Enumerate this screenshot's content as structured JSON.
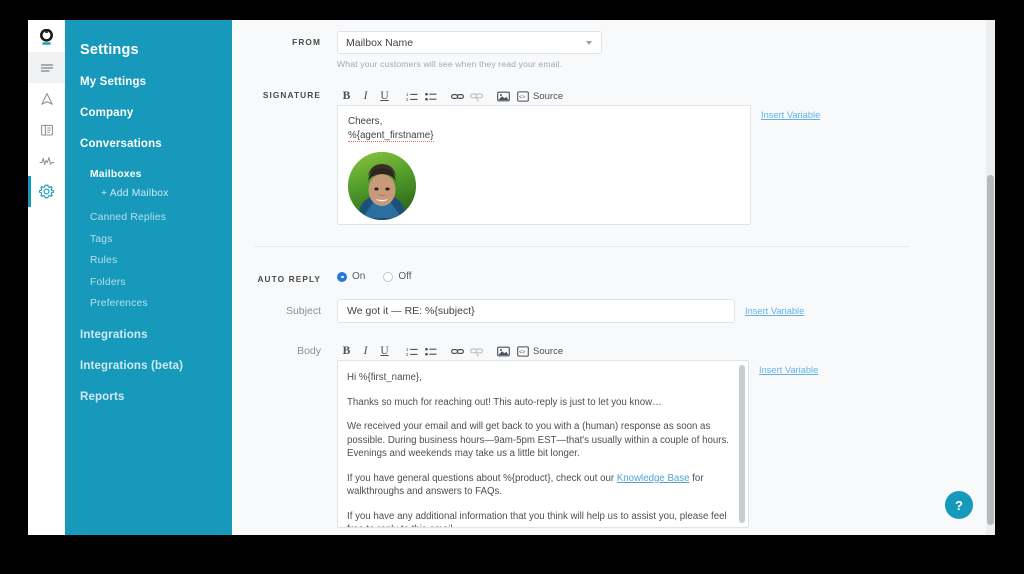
{
  "app": {
    "logo_icon": "groove-logo-icon",
    "rail_items": [
      {
        "name": "inbox-icon",
        "active": true
      },
      {
        "name": "navigation-icon",
        "active": false
      },
      {
        "name": "knowledge-base-icon",
        "active": false
      },
      {
        "name": "reports-pulse-icon",
        "active": false
      },
      {
        "name": "settings-gear-icon",
        "active": true
      }
    ],
    "accent_color": "#1799bc",
    "link_color": "#60b3e8",
    "radio_on_color": "#2479e0"
  },
  "sidebar": {
    "title": "Settings",
    "items": [
      {
        "label": "My Settings",
        "level": "top"
      },
      {
        "label": "Company",
        "level": "top"
      },
      {
        "label": "Conversations",
        "level": "top",
        "selected": true
      },
      {
        "label": "Mailboxes",
        "level": "sub",
        "selected": true
      },
      {
        "label": "+ Add Mailbox",
        "level": "add"
      },
      {
        "label": "Canned Replies",
        "level": "sub"
      },
      {
        "label": "Tags",
        "level": "sub"
      },
      {
        "label": "Rules",
        "level": "sub"
      },
      {
        "label": "Folders",
        "level": "sub"
      },
      {
        "label": "Preferences",
        "level": "sub"
      },
      {
        "label": "Integrations",
        "level": "top"
      },
      {
        "label": "Integrations (beta)",
        "level": "top"
      },
      {
        "label": "Reports",
        "level": "top"
      }
    ]
  },
  "main": {
    "from": {
      "label": "FROM",
      "value": "Mailbox Name",
      "help": "What your customers will see when they read your email."
    },
    "signature": {
      "label": "SIGNATURE",
      "toolbar": {
        "bold": "B",
        "italic": "I",
        "underline": "U",
        "ordered_list": "ordered-list-icon",
        "unordered_list": "unordered-list-icon",
        "link": "link-icon",
        "unlink": "unlink-icon",
        "image": "image-icon",
        "source_label": "Source"
      },
      "line1": "Cheers,",
      "line2": "%{agent_firstname}",
      "avatar_alt": "agent-avatar",
      "insert_variable": "Insert Variable"
    },
    "auto_reply": {
      "label": "AUTO REPLY",
      "option_on": "On",
      "option_off": "Off",
      "selected": "On",
      "subject_label": "Subject",
      "subject_value": "We got it — RE: %{subject}",
      "subject_insert_variable": "Insert Variable",
      "body_label": "Body",
      "body_insert_variable": "Insert Variable",
      "body_paragraphs": [
        "Hi %{first_name},",
        "Thanks so much for reaching out! This auto-reply is just to let you know…",
        "We received your email and will get back to you with a (human) response as soon as possible. During business hours—9am-5pm EST—that's usually within a couple of hours. Evenings and weekends may take us a little bit longer.",
        "If you have general questions about %{product}, check out our Knowledge Base for walkthroughs and answers to FAQs.",
        "If you have any additional information that you think will help us to assist you, please feel free to reply to this email."
      ],
      "body_link_text": "Knowledge Base"
    }
  },
  "help_button": {
    "label": "?"
  }
}
